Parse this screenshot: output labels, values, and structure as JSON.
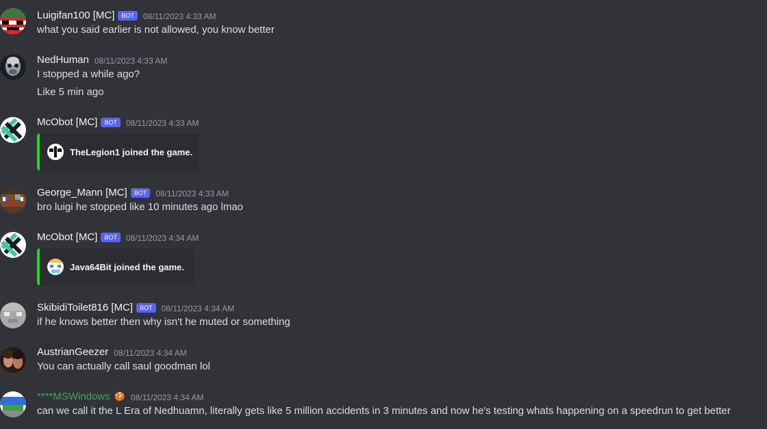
{
  "messages": [
    {
      "username": "Luigifan100 [MC]",
      "bot_tag": "BOT",
      "timestamp": "08/11/2023 4:33 AM",
      "lines": [
        "what you said earlier is not allowed, you know better"
      ]
    },
    {
      "username": "NedHuman",
      "timestamp": "08/11/2023 4:33 AM",
      "lines": [
        "I stopped a while ago?",
        "Like 5 min ago"
      ]
    },
    {
      "username": "McObot [MC]",
      "bot_tag": "BOT",
      "timestamp": "08/11/2023 4:33 AM",
      "embed": {
        "text": "TheLegion1 joined the game.",
        "accent_color": "#1eda19"
      }
    },
    {
      "username": "George_Mann [MC]",
      "bot_tag": "BOT",
      "timestamp": "08/11/2023 4:33 AM",
      "lines": [
        "bro luigi he stopped like 10 minutes ago lmao"
      ]
    },
    {
      "username": "McObot [MC]",
      "bot_tag": "BOT",
      "timestamp": "08/11/2023 4:34 AM",
      "embed": {
        "text": "Java64Bit joined the game.",
        "accent_color": "#1eda19"
      }
    },
    {
      "username": "SkibidiToilet816 [MC]",
      "bot_tag": "BOT",
      "timestamp": "08/11/2023 4:34 AM",
      "lines": [
        "if he knows better then why isn't he muted or something"
      ]
    },
    {
      "username": "AustrianGeezer",
      "timestamp": "08/11/2023 4:34 AM",
      "lines": [
        "You can actually call saul goodman lol"
      ]
    },
    {
      "username": "****MSWindows",
      "username_color": "#3ba55d",
      "badge": "🍪",
      "timestamp": "08/11/2023 4:34 AM",
      "lines": [
        "can we call it the L Era of Nedhuamn, literally gets like 5 million accidents in 3 minutes and now he's testing whats happening on a speedrun to get better"
      ]
    }
  ],
  "colors": {
    "background": "#313338",
    "bot_tag": "#5865f2",
    "embed_background": "#2b2d31",
    "timestamp": "#949ba4",
    "message_text": "#dbdee1"
  }
}
